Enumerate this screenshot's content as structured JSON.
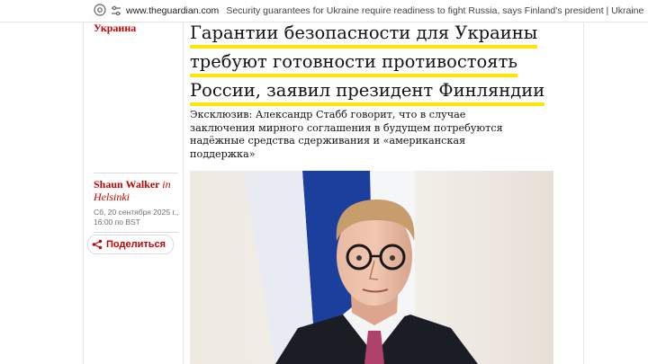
{
  "browser": {
    "url_domain": "www.theguardian.com",
    "url_title": "Security guarantees for Ukraine require readiness to fight Russia, says Finland's president | Ukraine | The Guar..."
  },
  "article": {
    "section": "Украина",
    "headline_lines": [
      "Гарантии безопасности для Украины",
      "требуют готовности противостоять",
      "России, заявил президент Финляндии"
    ],
    "standfirst": "Эксклюзив: Александр Стабб говорит, что в случае заключения мирного соглашения в будущем потребуются надёжные средства сдерживания и «американская поддержка»",
    "byline_name": "Shaun Walker",
    "byline_in": "in",
    "byline_place": "Helsinki",
    "dateline": "Сб, 20 сентября 2025 г., 16:00 по BST",
    "share_label": "Поделиться"
  },
  "colors": {
    "accent_red": "#c70000",
    "highlight_yellow": "#ffe500"
  }
}
